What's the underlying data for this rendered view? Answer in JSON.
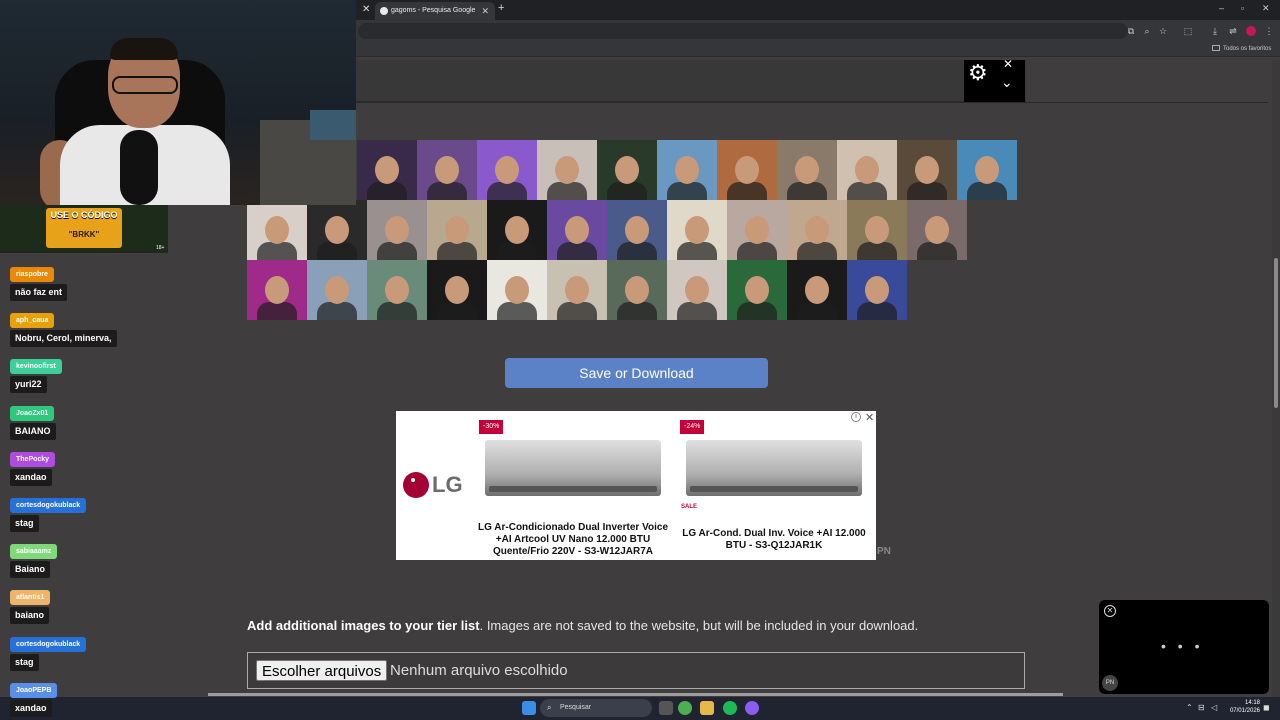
{
  "browser": {
    "tab_title": "gagoms - Pesquisa Google",
    "bookmarks_label": "Todos os favoritos"
  },
  "page": {
    "save_button": "Save or Download",
    "add_images_bold": "Add additional images to your tier list",
    "add_images_rest": ". Images are not saved to the website, but will be included in your download.",
    "file_button": "Escolher arquivos",
    "file_status": "Nenhum arquivo escolhido"
  },
  "ad": {
    "brand": "LG",
    "products": [
      {
        "discount": "-30%",
        "name": "LG Ar-Condicionado Dual Inverter Voice +AI Artcool UV Nano 12.000 BTU Quente/Frio 220V - S3-W12JAR7A"
      },
      {
        "discount": "-24%",
        "name": "LG Ar-Cond. Dual Inv. Voice +AI 12.000 BTU - S3-Q12JAR1K",
        "sale_label": "SALE"
      }
    ],
    "pn_mark": "PN"
  },
  "overlay": {
    "promo_title": "USE O CÓDIGO",
    "promo_code": "\"BRKK\"",
    "promo_age": "18+"
  },
  "chat": [
    {
      "user": "riaspobre",
      "color": "#e8890c",
      "message": "não faz ent"
    },
    {
      "user": "aph_caua",
      "color": "#e8a10c",
      "message": "Nobru, Cerol, minerva,"
    },
    {
      "user": "kevinoofirst",
      "color": "#3ccf9a",
      "message": "yuri22"
    },
    {
      "user": "JoaoZx01",
      "color": "#2ec97d",
      "message": "BAIANO"
    },
    {
      "user": "ThePocky",
      "color": "#b04be0",
      "message": "xandao"
    },
    {
      "user": "cortesdogokublack",
      "color": "#2670d9",
      "message": "stag"
    },
    {
      "user": "sabiaaamz",
      "color": "#7fd97a",
      "message": "Baiano"
    },
    {
      "user": "atlantis1",
      "color": "#f0b36a",
      "message": "baiano"
    },
    {
      "user": "cortesdogokublack",
      "color": "#2670d9",
      "message": "stag"
    },
    {
      "user": "JoaoPEPB",
      "color": "#5a8fe8",
      "message": "xandao"
    }
  ],
  "player": {
    "dots": "• • •",
    "logo": "PN"
  },
  "taskbar": {
    "search_placeholder": "Pesquisar",
    "time": "14:18",
    "date": "07/01/2026"
  },
  "tier_tiles": {
    "row1_colors": [
      "#3a2a4a",
      "#6a4a8a",
      "#8a5acc",
      "#c8c0b8",
      "#2a3a2a",
      "#6a98c0",
      "#b06a40",
      "#8a7a6a",
      "#d0c0b0",
      "#5a4a3a",
      "#4a8ab8"
    ],
    "row2_colors": [
      "#d8d0c8",
      "#2a2a2a",
      "#9a9090",
      "#b8a890",
      "#1a1a1a",
      "#6a4aa0",
      "#4a5a8a",
      "#e0d8c8",
      "#b8a8a0",
      "#c0a890",
      "#8a7a5a",
      "#7a6a6a"
    ],
    "row3_colors": [
      "#a02a8a",
      "#8aa0b8",
      "#6a8a7a",
      "#1a1a1a",
      "#e8e8e0",
      "#c8c0b0",
      "#5a6a5a",
      "#d0c8c0",
      "#2a6a3a",
      "#1a1a1a",
      "#3a4a9a"
    ]
  }
}
